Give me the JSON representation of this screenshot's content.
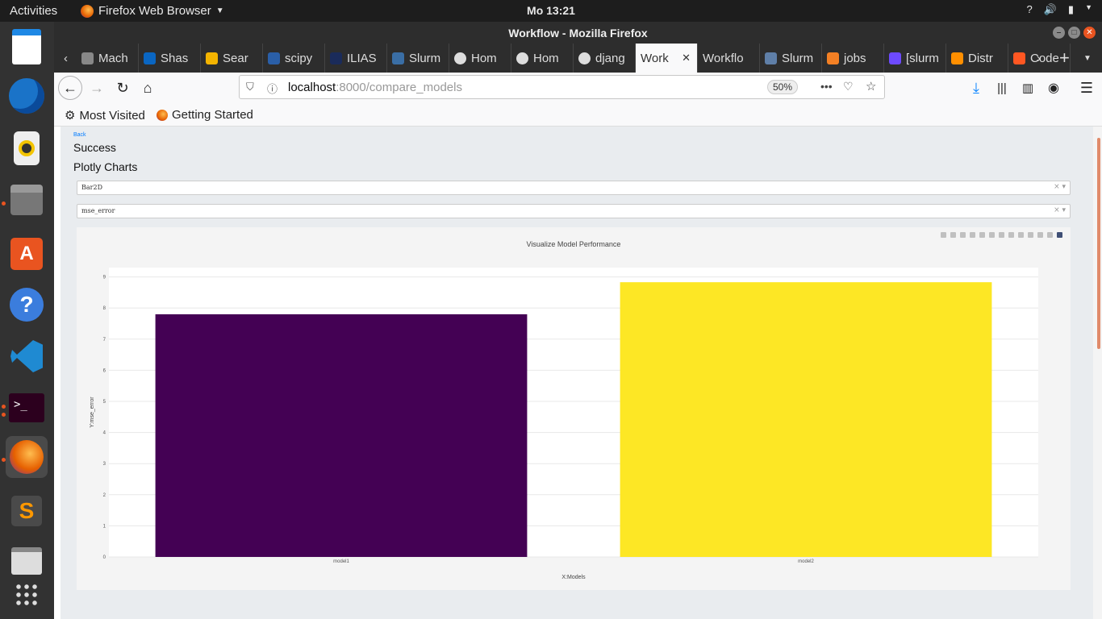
{
  "topbar": {
    "activities": "Activities",
    "app_name": "Firefox Web Browser",
    "clock": "Mo 13:21"
  },
  "window": {
    "title": "Workflow - Mozilla Firefox"
  },
  "tabs": [
    {
      "label": "Mach",
      "icon": "generic-page-icon"
    },
    {
      "label": "Shas",
      "icon": "linkedin-icon"
    },
    {
      "label": "Sear",
      "icon": "google-drive-icon"
    },
    {
      "label": "scipy",
      "icon": "scipy-icon"
    },
    {
      "label": "ILIAS",
      "icon": "ilias-icon"
    },
    {
      "label": "Slurm",
      "icon": "slurm-icon"
    },
    {
      "label": "Hom",
      "icon": "github-icon"
    },
    {
      "label": "Hom",
      "icon": "github-icon"
    },
    {
      "label": "djang",
      "icon": "github-icon"
    },
    {
      "label": "Work",
      "icon": "",
      "active": true
    },
    {
      "label": "Workflo",
      "icon": ""
    },
    {
      "label": "Slurm",
      "icon": "slurm-doc-icon"
    },
    {
      "label": "jobs",
      "icon": "stackoverflow-icon"
    },
    {
      "label": "[slurm",
      "icon": "chat-icon"
    },
    {
      "label": "Distr",
      "icon": "tensorflow-icon"
    },
    {
      "label": "Code",
      "icon": "blogger-icon"
    }
  ],
  "navbar": {
    "url_host": "localhost",
    "url_rest": ":8000/compare_models",
    "zoom": "50%"
  },
  "bookmarks": [
    {
      "label": "Most Visited",
      "icon": "gear-icon"
    },
    {
      "label": "Getting Started",
      "icon": "firefox-icon"
    }
  ],
  "page": {
    "back_link": "Back",
    "status": "Success",
    "heading": "Plotly Charts",
    "chart_type_select": "Bar2D",
    "metric_select": "mse_error"
  },
  "colors": {
    "bar1": "#440154",
    "bar2": "#fde725",
    "accent": "#e95420",
    "link": "#007bff"
  },
  "chart_data": {
    "type": "bar",
    "title": "Visualize Model Performance",
    "xlabel": "X:Models",
    "ylabel": "Y:mse_error",
    "categories": [
      "model1",
      "model2"
    ],
    "values": [
      7.8,
      8.83
    ],
    "yticks": [
      0,
      1,
      2,
      3,
      4,
      5,
      6,
      7,
      8,
      9
    ],
    "ylim": [
      0,
      9.3
    ],
    "grid": true,
    "legend": "none"
  }
}
